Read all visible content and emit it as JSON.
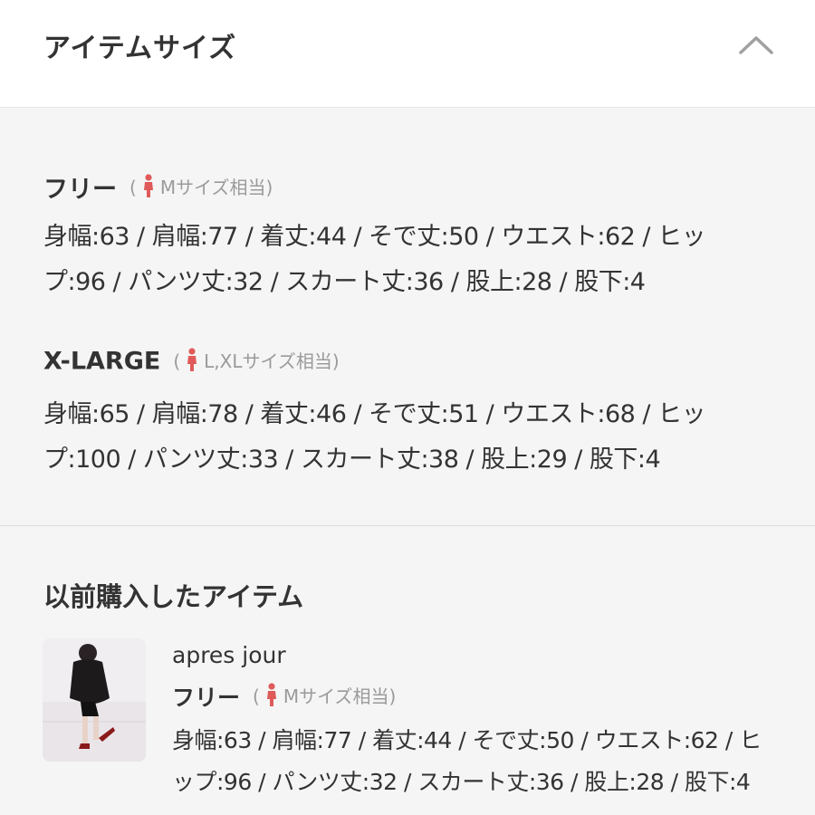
{
  "header": {
    "title": "アイテムサイズ"
  },
  "icons": {
    "collapse": "chevron-up-icon",
    "person": "person-icon"
  },
  "colors": {
    "person_icon": "#e05a5a",
    "equiv_text": "#9a9a9a",
    "section_bg": "#f5f5f5"
  },
  "sizes": [
    {
      "name": "フリー",
      "equiv_open": "(",
      "equiv_label": "Mサイズ相当)",
      "measurements": "身幅:63 / 肩幅:77 / 着丈:44 / そで丈:50 / ウエスト:62 / ヒップ:96 / パンツ丈:32 / スカート丈:36 / 股上:28 / 股下:4"
    },
    {
      "name": "X-LARGE",
      "equiv_open": "(",
      "equiv_label": "L,XLサイズ相当)",
      "measurements": "身幅:65 / 肩幅:78 / 着丈:46 / そで丈:51 / ウエスト:68 / ヒップ:100 / パンツ丈:33 / スカート丈:38 / 股上:29 / 股下:4"
    }
  ],
  "previous": {
    "title": "以前購入したアイテム",
    "item": {
      "brand": "apres jour",
      "size_name": "フリー",
      "equiv_open": "(",
      "equiv_label": "Mサイズ相当)",
      "measurements": "身幅:63 / 肩幅:77 / 着丈:44 / そで丈:50 / ウエスト:62 / ヒップ:96 / パンツ丈:32 / スカート丈:36 / 股上:28 / 股下:4"
    }
  }
}
